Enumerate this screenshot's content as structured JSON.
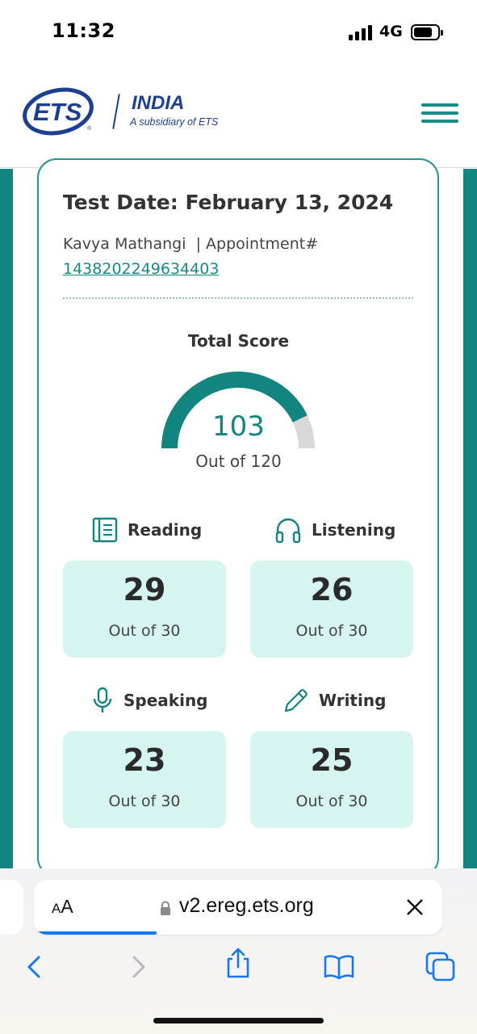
{
  "status_bar": {
    "time": "11:32",
    "network": "4G"
  },
  "header": {
    "logo_text": "ETS",
    "title": "INDIA",
    "subtitle": "A subsidiary of ETS",
    "accent": "#1a8a86",
    "brand_blue": "#1c3f94"
  },
  "result": {
    "test_date": "Test Date: February 13, 2024",
    "candidate_line": "Kavya Mathangi  | Appointment#",
    "appointment_number": "1438202249634403",
    "total_label": "Total Score",
    "total_score": "103",
    "total_out_of": "Out of 120",
    "total_fraction": 0.8583,
    "sections": [
      {
        "label": "Reading",
        "icon": "book-icon",
        "score": "29",
        "out_of": "Out of 30"
      },
      {
        "label": "Listening",
        "icon": "headphones-icon",
        "score": "26",
        "out_of": "Out of 30"
      },
      {
        "label": "Speaking",
        "icon": "microphone-icon",
        "score": "23",
        "out_of": "Out of 30"
      },
      {
        "label": "Writing",
        "icon": "pencil-icon",
        "score": "25",
        "out_of": "Out of 30"
      }
    ],
    "box_color": "#d6f5f0",
    "gauge_color": "#128581",
    "gauge_track": "#d9d9d9"
  },
  "browser": {
    "text_size_small": "A",
    "text_size_large": "A",
    "url": "v2.ereg.ets.org",
    "load_progress": 0.3,
    "toolbar": [
      "back-icon",
      "forward-icon",
      "share-icon",
      "bookmarks-icon",
      "tabs-icon"
    ]
  }
}
